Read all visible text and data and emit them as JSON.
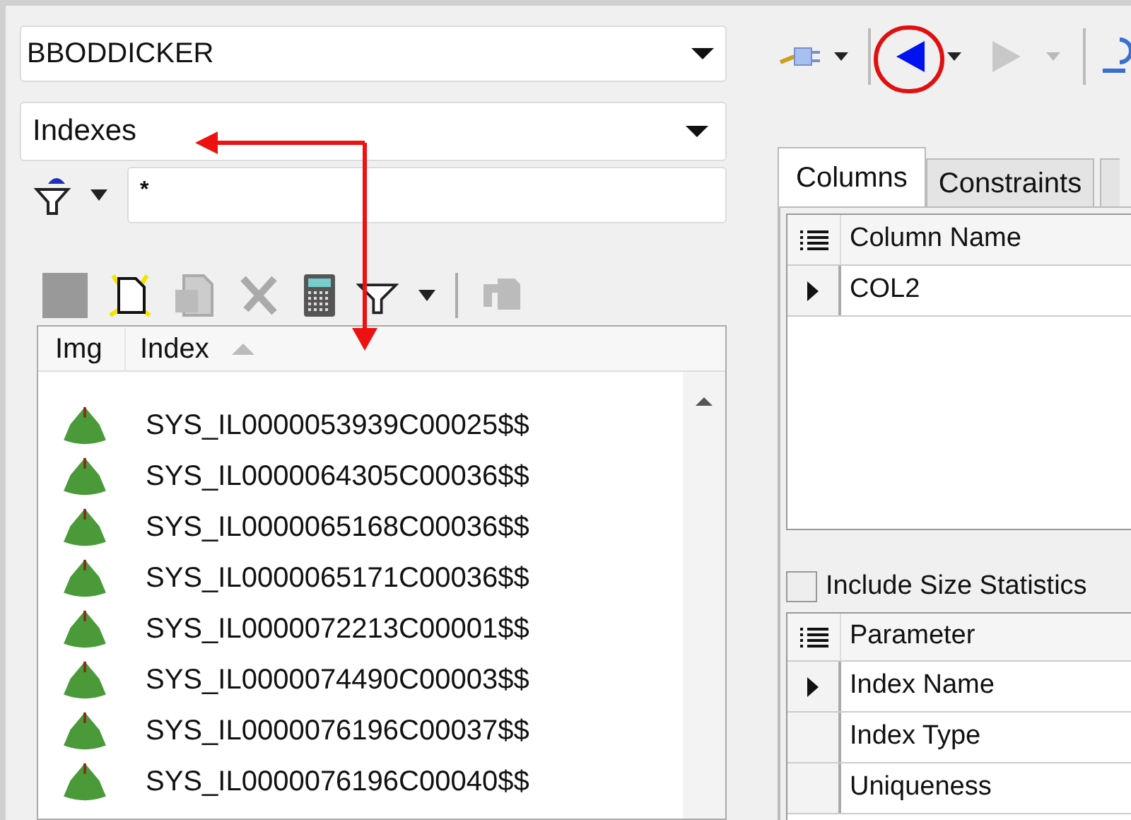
{
  "schema_combo": {
    "value": "BBODDICKER"
  },
  "object_type_combo": {
    "value": "Indexes"
  },
  "filter": {
    "value": "*"
  },
  "index_list": {
    "columns": [
      "Img",
      "Index"
    ],
    "rows": [
      {
        "name": "SYS_IL0000053939C00025$$"
      },
      {
        "name": "SYS_IL0000064305C00036$$"
      },
      {
        "name": "SYS_IL0000065168C00036$$"
      },
      {
        "name": "SYS_IL0000065171C00036$$"
      },
      {
        "name": "SYS_IL0000072213C00001$$"
      },
      {
        "name": "SYS_IL0000074490C00003$$"
      },
      {
        "name": "SYS_IL0000076196C00037$$"
      },
      {
        "name": "SYS_IL0000076196C00040$$"
      }
    ]
  },
  "tabs": [
    {
      "label": "Columns",
      "selected": true
    },
    {
      "label": "Constraints",
      "selected": false
    }
  ],
  "columns_grid": {
    "header": "Column Name",
    "rows": [
      {
        "value": "COL2",
        "current": true
      }
    ]
  },
  "include_size_statistics": {
    "label": "Include Size Statistics",
    "checked": false
  },
  "parameter_grid": {
    "header": "Parameter",
    "rows": [
      {
        "value": "Index Name",
        "current": true
      },
      {
        "value": "Index Type",
        "current": false
      },
      {
        "value": "Uniqueness",
        "current": false
      }
    ]
  }
}
